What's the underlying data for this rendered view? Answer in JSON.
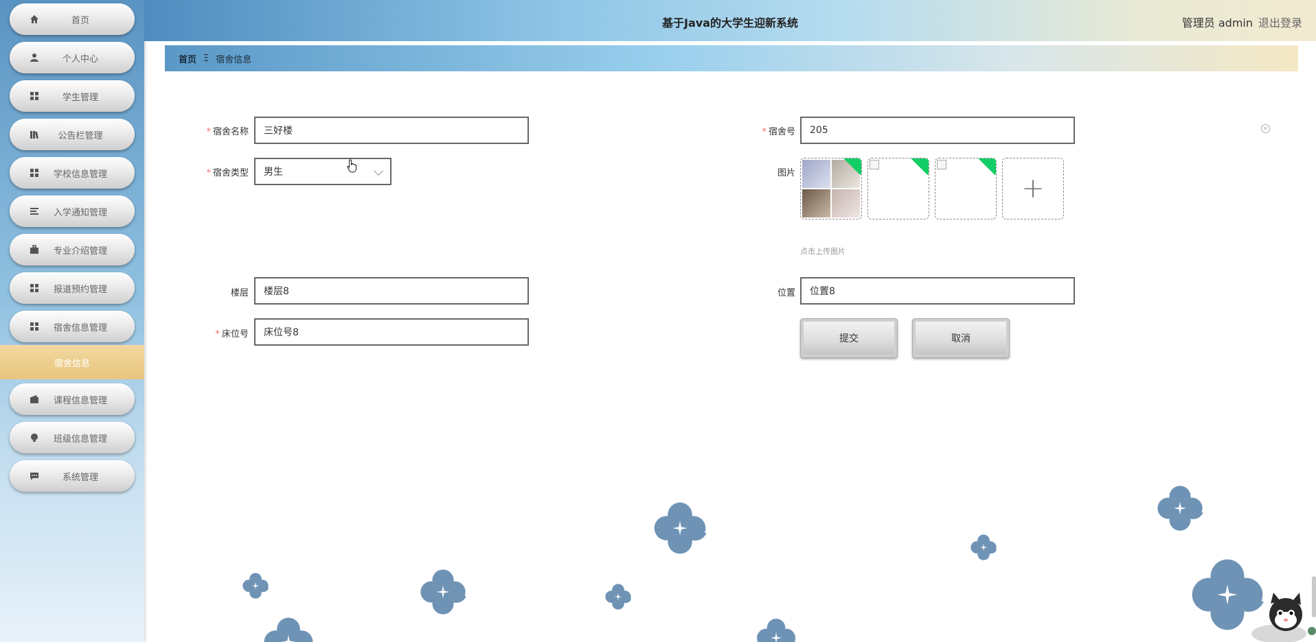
{
  "header": {
    "title": "基于Java的大学生迎新系统",
    "user": "管理员 admin",
    "logout": "退出登录"
  },
  "sidebar": {
    "items": [
      {
        "label": "首页",
        "icon": "home-icon"
      },
      {
        "label": "个人中心",
        "icon": "user-icon"
      },
      {
        "label": "学生管理",
        "icon": "grid-icon"
      },
      {
        "label": "公告栏管理",
        "icon": "book-icon"
      },
      {
        "label": "学校信息管理",
        "icon": "grid-icon"
      },
      {
        "label": "入学通知管理",
        "icon": "list-icon"
      },
      {
        "label": "专业介绍管理",
        "icon": "briefcase-icon"
      },
      {
        "label": "报道预约管理",
        "icon": "grid-icon"
      },
      {
        "label": "宿舍信息管理",
        "icon": "grid-icon"
      },
      {
        "label": "课程信息管理",
        "icon": "wallet-icon"
      },
      {
        "label": "班级信息管理",
        "icon": "bulb-icon"
      },
      {
        "label": "系统管理",
        "icon": "chat-icon"
      }
    ],
    "active_sub": "宿舍信息"
  },
  "breadcrumb": {
    "home": "首页",
    "separator": "Ξ",
    "current": "宿舍信息"
  },
  "form": {
    "dorm_name": {
      "label": "宿舍名称",
      "value": "三好楼",
      "required": true
    },
    "dorm_no": {
      "label": "宿舍号",
      "value": "205",
      "required": true
    },
    "dorm_type": {
      "label": "宿舍类型",
      "value": "男生",
      "required": true
    },
    "images": {
      "label": "图片",
      "hint": "点击上传图片",
      "add_symbol": "+"
    },
    "floor": {
      "label": "楼层",
      "value": "楼层8"
    },
    "location": {
      "label": "位置",
      "value": "位置8"
    },
    "bed_no": {
      "label": "床位号",
      "value": "床位号8",
      "required": true
    },
    "required_mark": "*"
  },
  "actions": {
    "submit": "提交",
    "cancel": "取消"
  },
  "colors": {
    "required": "#f56c6c",
    "upload_success": "#13ce66",
    "flower": "#6f93b5",
    "active_menu": "#e9c57e"
  }
}
